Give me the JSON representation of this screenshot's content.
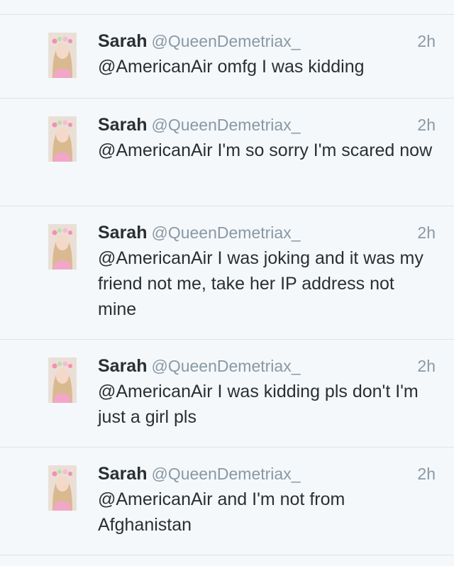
{
  "tweets": [
    {
      "name": "Sarah",
      "handle": "@QueenDemetriax_",
      "time": "2h",
      "text": "@AmericanAir omfg I was kidding"
    },
    {
      "name": "Sarah",
      "handle": "@QueenDemetriax_",
      "time": "2h",
      "text": "@AmericanAir I'm so sorry I'm scared now"
    },
    {
      "name": "Sarah",
      "handle": "@QueenDemetriax_",
      "time": "2h",
      "text": "@AmericanAir I was joking and it was my friend not me, take her IP address not mine"
    },
    {
      "name": "Sarah",
      "handle": "@QueenDemetriax_",
      "time": "2h",
      "text": "@AmericanAir I was kidding pls don't I'm just a girl pls"
    },
    {
      "name": "Sarah",
      "handle": "@QueenDemetriax_",
      "time": "2h",
      "text": "@AmericanAir and I'm not from Afghanistan"
    }
  ]
}
